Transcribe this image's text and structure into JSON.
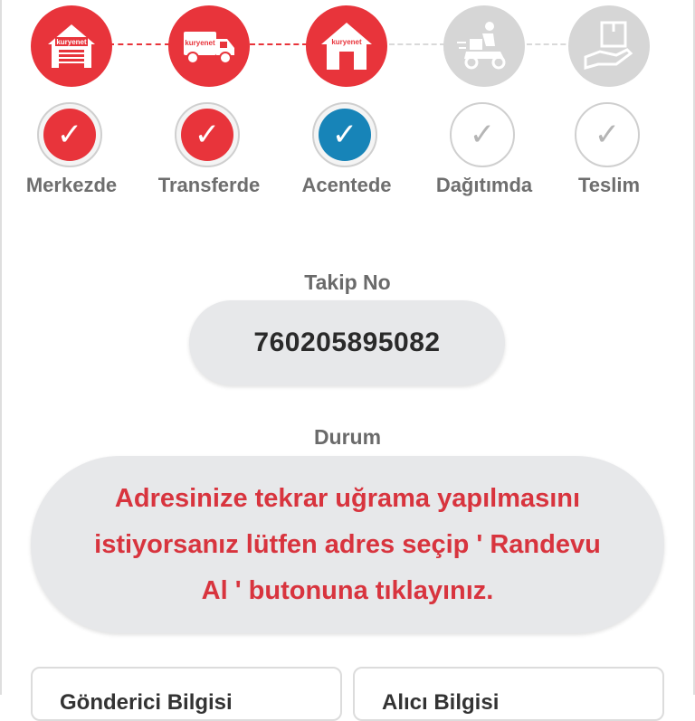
{
  "brand": {
    "logo_text": "kuryenet",
    "accent": "#e8343b",
    "active": "#1784b8",
    "inactive": "#d6d6d6"
  },
  "steps": [
    {
      "label": "Merkezde",
      "icon": "warehouse-icon",
      "state": "done"
    },
    {
      "label": "Transferde",
      "icon": "delivery-truck-icon",
      "state": "done"
    },
    {
      "label": "Acentede",
      "icon": "branch-house-icon",
      "state": "current"
    },
    {
      "label": "Dağıtımda",
      "icon": "courier-scooter-icon",
      "state": "pending"
    },
    {
      "label": "Teslim",
      "icon": "package-hand-icon",
      "state": "pending"
    }
  ],
  "check_glyph": "✓",
  "tracking": {
    "label": "Takip No",
    "value": "760205895082"
  },
  "status": {
    "label": "Durum",
    "message": "Adresinize tekrar uğrama yapılmasını istiyorsanız lütfen adres seçip ' Randevu Al ' butonuna tıklayınız."
  },
  "cards": {
    "sender": "Gönderici Bilgisi",
    "receiver": "Alıcı Bilgisi"
  }
}
